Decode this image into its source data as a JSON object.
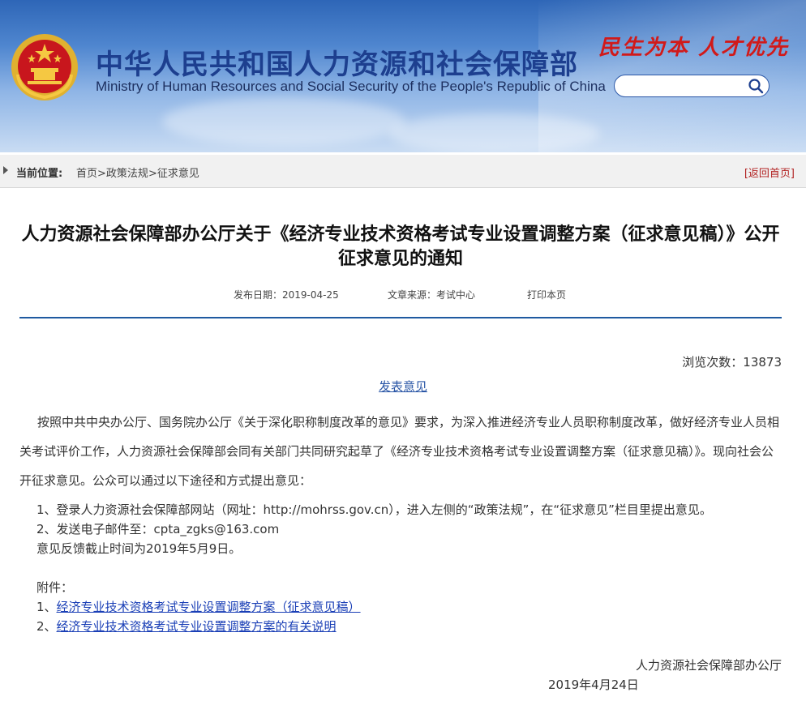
{
  "header": {
    "title_cn": "中华人民共和国人力资源和社会保障部",
    "title_en": "Ministry of Human Resources and Social Security of the People's Republic of China",
    "slogan": "民生为本 人才优先",
    "search": {
      "value": "",
      "placeholder": ""
    }
  },
  "breadcrumb": {
    "label": "当前位置:",
    "items": [
      "首页",
      "政策法规",
      "征求意见"
    ],
    "separator": ">",
    "back_home": "[返回首页]"
  },
  "article": {
    "title": "人力资源社会保障部办公厅关于《经济专业技术资格考试专业设置调整方案（征求意见稿）》公开征求意见的通知",
    "publish_date_label": "发布日期：",
    "publish_date": "2019-04-25",
    "source_label": "文章来源：",
    "source": "考试中心",
    "print_label": "打印本页",
    "views_label": "浏览次数：",
    "views": "13873",
    "feedback_link": "发表意见",
    "intro": "按照中共中央办公厅、国务院办公厅《关于深化职称制度改革的意见》要求，为深入推进经济专业人员职称制度改革，做好经济专业人员相关考试评价工作，人力资源社会保障部会同有关部门共同研究起草了《经济专业技术资格考试专业设置调整方案（征求意见稿）》。现向社会公开征求意见。公众可以通过以下途径和方式提出意见：",
    "way1": "1、登录人力资源社会保障部网站（网址：http://mohrss.gov.cn），进入左侧的“政策法规”，在“征求意见”栏目里提出意见。",
    "way2": "2、发送电子邮件至：cpta_zgks@163.com",
    "deadline": "意见反馈截止时间为2019年5月9日。",
    "attachments_label": "附件：",
    "attachments": [
      {
        "prefix": "1、",
        "text": "经济专业技术资格考试专业设置调整方案（征求意见稿）"
      },
      {
        "prefix": "2、",
        "text": "经济专业技术资格考试专业设置调整方案的有关说明"
      }
    ],
    "signature_org": "人力资源社会保障部办公厅",
    "signature_date": "2019年4月24日"
  },
  "colors": {
    "banner_blue": "#2e66b7",
    "title_blue": "#1d3f8f",
    "slogan_red": "#d11a1a",
    "link_blue": "#1a3fb6",
    "divider": "#1f5aa0"
  }
}
